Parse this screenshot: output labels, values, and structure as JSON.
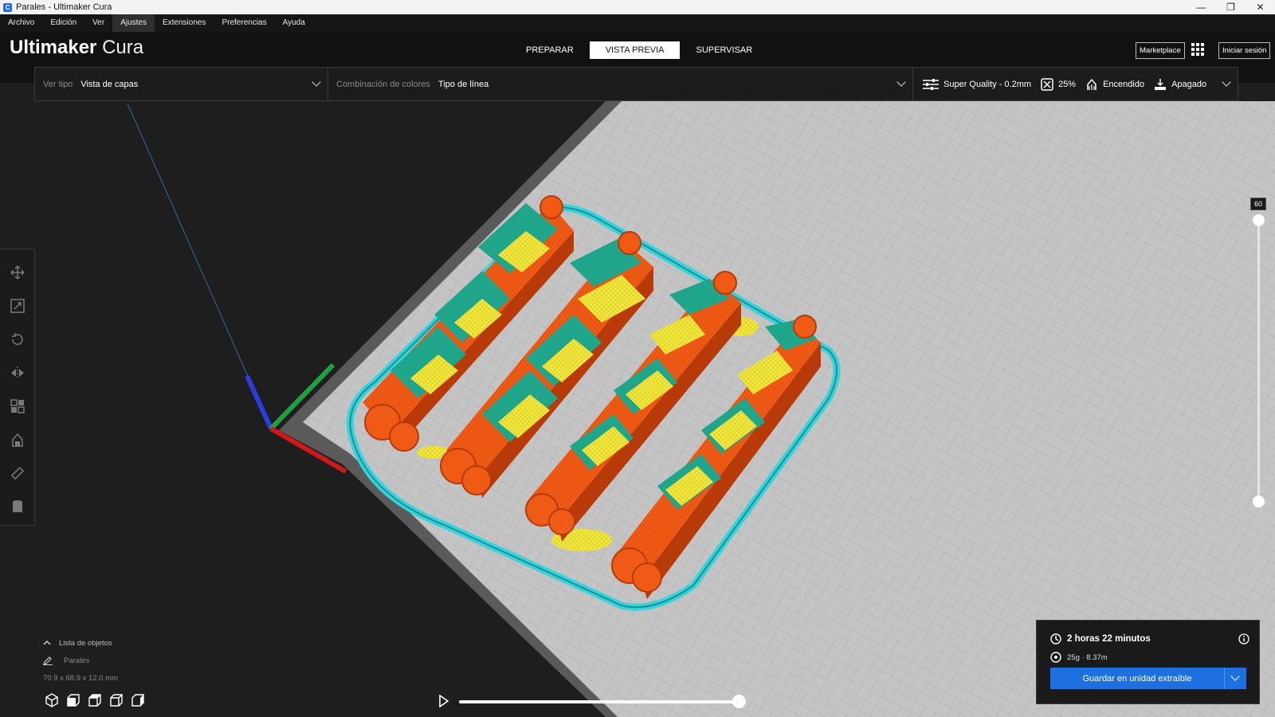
{
  "window": {
    "title": "Parales - Ultimaker Cura",
    "controls": [
      "—",
      "❐",
      "✕"
    ]
  },
  "menu": [
    "Archivo",
    "Edición",
    "Ver",
    "Ajustes",
    "Extensiones",
    "Preferencias",
    "Ayuda"
  ],
  "menu_active": "Ajustes",
  "header": {
    "logo_bold": "Ultimaker",
    "logo_light": "Cura",
    "stages": [
      "PREPARAR",
      "VISTA PREVIA",
      "SUPERVISAR"
    ],
    "active_stage": "VISTA PREVIA",
    "marketplace": "Marketplace",
    "signin": "Iniciar sesión",
    "apps_icon": "grid-icon"
  },
  "toolbar": {
    "view_type_label": "Ver tipo",
    "view_type_value": "Vista de capas",
    "color_scheme_label": "Combinación de colores",
    "color_scheme_value": "Tipo de línea",
    "profile": "Super Quality - 0.2mm",
    "infill": "25%",
    "support": "Encendido",
    "adhesion": "Apagado"
  },
  "tools": [
    "move-icon",
    "scale-icon",
    "rotate-icon",
    "mirror-icon",
    "per-model-settings-icon",
    "support-blocker-icon",
    "measure-icon",
    "layer-icon"
  ],
  "layer_slider": {
    "top_layer": "60",
    "max_layer": 60,
    "min_layer": 1
  },
  "objects": {
    "header": "Lista de objetos",
    "name": "Parales",
    "dimensions": "70.9 x 68.9 x 12.0 mm"
  },
  "playback": {
    "progress": 1.0
  },
  "print_info": {
    "time": "2 horas 22 minutos",
    "material": "25g · 8.37m",
    "save_button": "Guardar en unidad extraíble"
  },
  "colors": {
    "accent": "#1e6fe0",
    "wall_outer": "#ef5a14",
    "wall_inner": "#1fa58a",
    "infill": "#f2e844",
    "skirt": "#35d4dc",
    "plate": "#bfbfbf"
  }
}
